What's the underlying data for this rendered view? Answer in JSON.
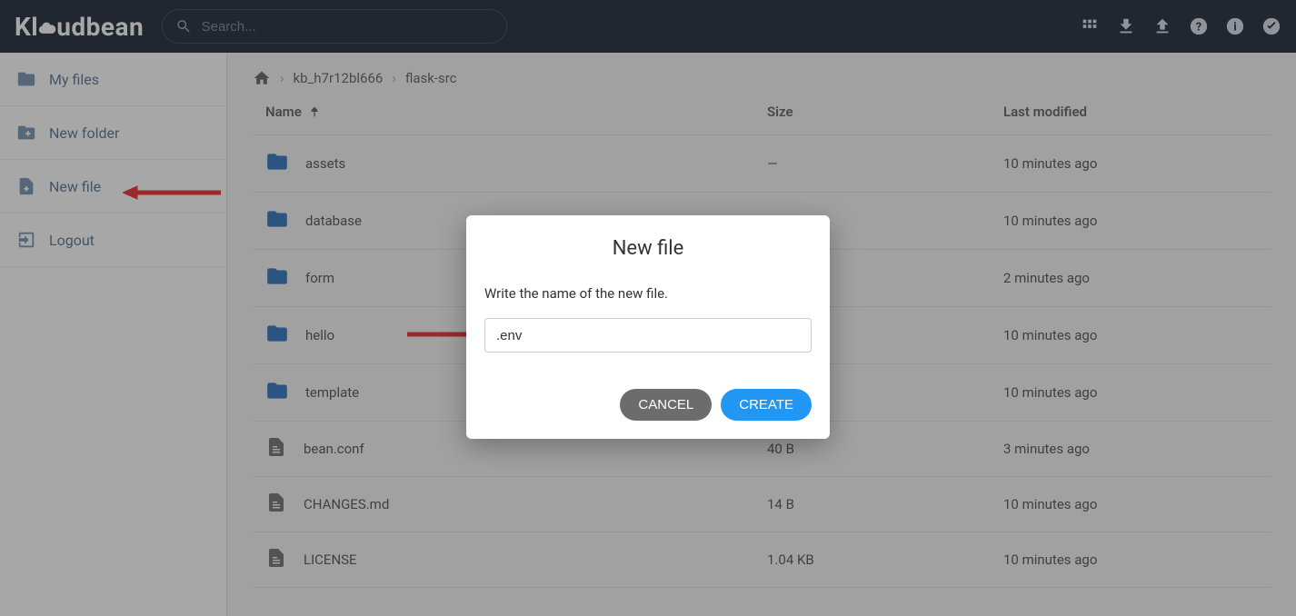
{
  "brand": {
    "name": "Kloudbean"
  },
  "search": {
    "placeholder": "Search..."
  },
  "sidebar": {
    "my_files": "My files",
    "new_folder": "New folder",
    "new_file": "New file",
    "logout": "Logout"
  },
  "breadcrumb": {
    "item1": "kb_h7r12bl666",
    "item2": "flask-src"
  },
  "columns": {
    "name": "Name",
    "size": "Size",
    "modified": "Last modified"
  },
  "rows": [
    {
      "type": "folder",
      "name": "assets",
      "size": "—",
      "modified": "10 minutes ago"
    },
    {
      "type": "folder",
      "name": "database",
      "size": "",
      "modified": "10 minutes ago"
    },
    {
      "type": "folder",
      "name": "form",
      "size": "",
      "modified": "2 minutes ago"
    },
    {
      "type": "folder",
      "name": "hello",
      "size": "",
      "modified": "10 minutes ago"
    },
    {
      "type": "folder",
      "name": "template",
      "size": "",
      "modified": "10 minutes ago"
    },
    {
      "type": "file",
      "name": "bean.conf",
      "size": "40 B",
      "modified": "3 minutes ago"
    },
    {
      "type": "file",
      "name": "CHANGES.md",
      "size": "14 B",
      "modified": "10 minutes ago"
    },
    {
      "type": "file",
      "name": "LICENSE",
      "size": "1.04 KB",
      "modified": "10 minutes ago"
    }
  ],
  "modal": {
    "title": "New file",
    "label": "Write the name of the new file.",
    "value": ".env",
    "cancel": "CANCEL",
    "create": "CREATE"
  }
}
